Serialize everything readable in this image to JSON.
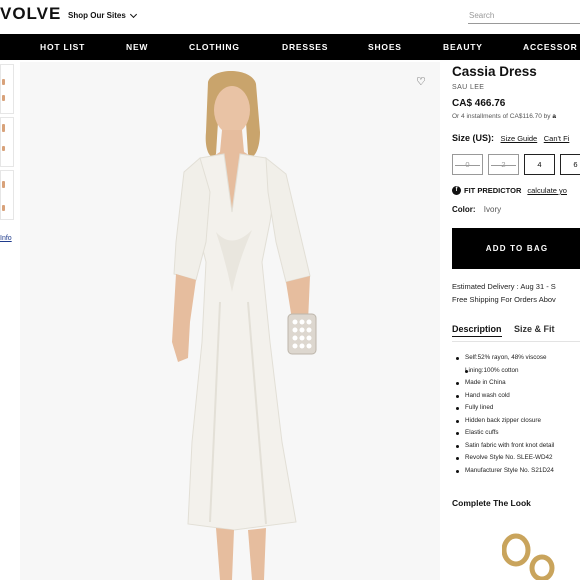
{
  "header": {
    "logo": "VOLVE",
    "shop_sites": "Shop Our Sites",
    "search_placeholder": "Search"
  },
  "nav": {
    "items": [
      "HOT LIST",
      "NEW",
      "CLOTHING",
      "DRESSES",
      "SHOES",
      "BEAUTY",
      "ACCESSOR"
    ]
  },
  "left": {
    "more_info": "Info"
  },
  "product": {
    "title": "Cassia Dress",
    "brand": "SAU LEE",
    "price": "CA$ 466.76",
    "installments_prefix": "Or 4 installments of CA$116.70 by",
    "installments_brand": "a",
    "size_label": "Size (US):",
    "size_guide": "Size Guide",
    "cant_find": "Can't Fi",
    "sizes": [
      {
        "label": "0",
        "available": false
      },
      {
        "label": "2",
        "available": false
      },
      {
        "label": "4",
        "available": true
      },
      {
        "label": "6",
        "available": true
      }
    ],
    "fit_predictor": "FIT PREDICTOR",
    "fit_link": "calculate yo",
    "color_label": "Color:",
    "color_value": "Ivory",
    "add_to_bag": "ADD TO BAG",
    "delivery": "Estimated Delivery : Aug 31 - S",
    "shipping": "Free Shipping For Orders Abov",
    "tabs": [
      "Description",
      "Size & Fit"
    ],
    "details": [
      "Self:52% rayon, 48% viscose",
      "Lining:100% cotton",
      "Made in China",
      "Hand wash cold",
      "Fully lined",
      "Hidden back zipper closure",
      "Elastic cuffs",
      "Satin fabric with front knot detail",
      "Revolve Style No. SLEE-WD42",
      "Manufacturer Style No. S21D24"
    ],
    "complete_look": "Complete The Look"
  },
  "colors": {
    "nav_bg": "#000000",
    "accent": "#111111",
    "dress": "#f3f1ec"
  }
}
